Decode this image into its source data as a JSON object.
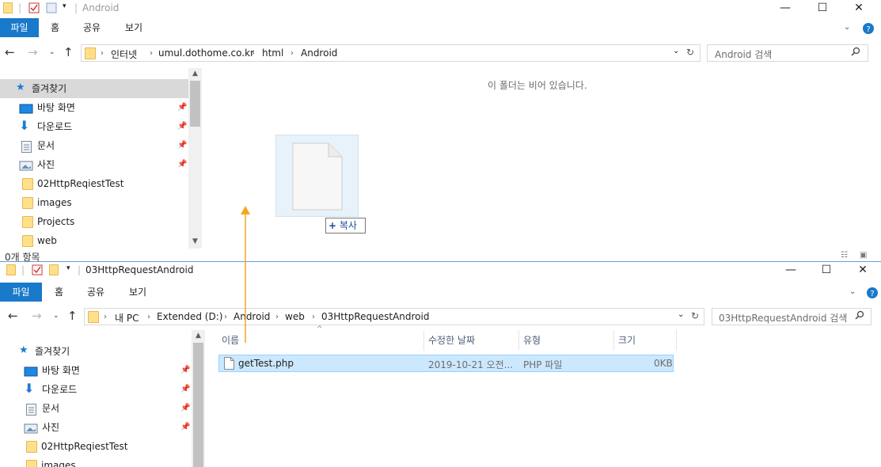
{
  "top_window": {
    "title": "Android",
    "controls": {
      "minimize": "—",
      "maximize": "☐",
      "close": "✕"
    },
    "ribbon": {
      "file": "파일",
      "home": "홈",
      "share": "공유",
      "view": "보기"
    },
    "breadcrumb": [
      "인터넷",
      "umul.dothome.co.kr",
      "html",
      "Android"
    ],
    "search_placeholder": "Android 검색",
    "empty_message": "이 폴더는 비어 있습니다.",
    "drag_badge": "복사",
    "status": "0개 항목",
    "nav": [
      {
        "label": "즐겨찾기",
        "icon": "star-icon"
      },
      {
        "label": "바탕 화면",
        "icon": "desktop-icon",
        "pinned": true
      },
      {
        "label": "다운로드",
        "icon": "download-icon",
        "pinned": true
      },
      {
        "label": "문서",
        "icon": "document-icon",
        "pinned": true
      },
      {
        "label": "사진",
        "icon": "pictures-icon",
        "pinned": true
      },
      {
        "label": "02HttpReqiestTest",
        "icon": "folder-icon"
      },
      {
        "label": "images",
        "icon": "folder-icon"
      },
      {
        "label": "Projects",
        "icon": "folder-icon"
      },
      {
        "label": "web",
        "icon": "folder-icon"
      }
    ]
  },
  "bottom_window": {
    "title": "03HttpRequestAndroid",
    "controls": {
      "minimize": "—",
      "maximize": "☐",
      "close": "✕"
    },
    "ribbon": {
      "file": "파일",
      "home": "홈",
      "share": "공유",
      "view": "보기"
    },
    "breadcrumb": [
      "내 PC",
      "Extended (D:)",
      "Android",
      "web",
      "03HttpRequestAndroid"
    ],
    "search_placeholder": "03HttpRequestAndroid 검색",
    "columns": [
      "이름",
      "수정한 날짜",
      "유형",
      "크기"
    ],
    "files": [
      {
        "name": "getTest.php",
        "modified": "2019-10-21 오전...",
        "type": "PHP 파일",
        "size": "0KB"
      }
    ],
    "nav": [
      {
        "label": "즐겨찾기",
        "icon": "star-icon"
      },
      {
        "label": "바탕 화면",
        "icon": "desktop-icon",
        "pinned": true
      },
      {
        "label": "다운로드",
        "icon": "download-icon",
        "pinned": true
      },
      {
        "label": "문서",
        "icon": "document-icon",
        "pinned": true
      },
      {
        "label": "사진",
        "icon": "pictures-icon",
        "pinned": true
      },
      {
        "label": "02HttpReqiestTest",
        "icon": "folder-icon"
      },
      {
        "label": "images",
        "icon": "folder-icon"
      }
    ]
  },
  "colors": {
    "accent": "#1979ca",
    "selection": "#cce8ff",
    "drag_line": "#f5a623"
  }
}
